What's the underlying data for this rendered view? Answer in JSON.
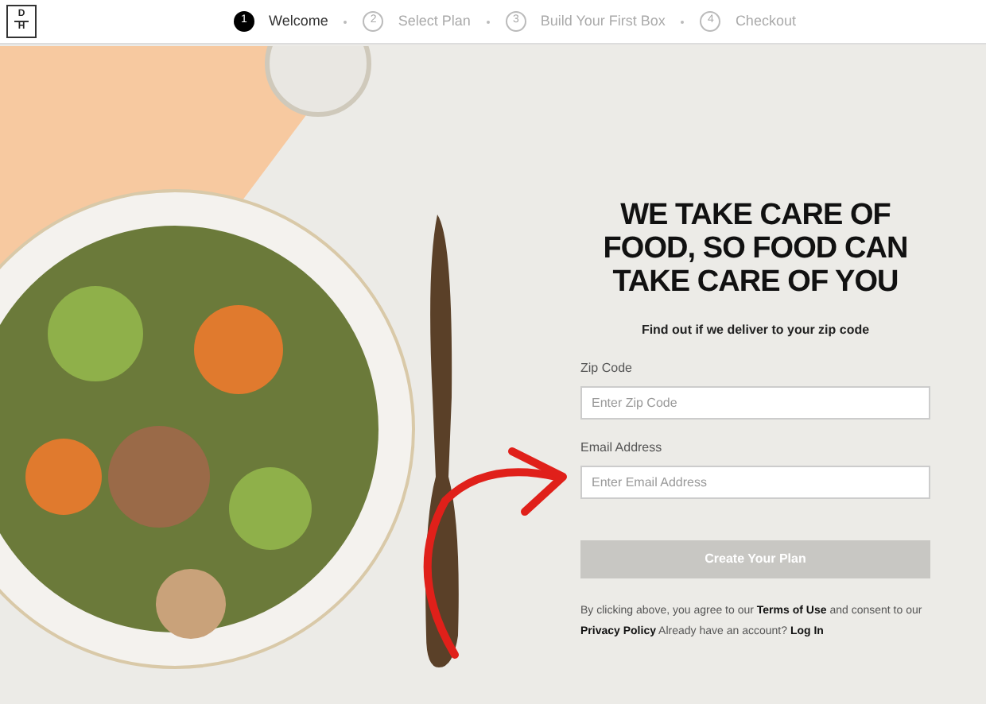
{
  "logo": {
    "top": "D",
    "bottom": "H"
  },
  "steps": [
    {
      "number": "1",
      "label": "Welcome",
      "selected": true
    },
    {
      "number": "2",
      "label": "Select Plan",
      "selected": false
    },
    {
      "number": "3",
      "label": "Build Your First Box",
      "selected": false
    },
    {
      "number": "4",
      "label": "Checkout",
      "selected": false
    }
  ],
  "heading": "WE TAKE CARE OF FOOD, SO FOOD CAN TAKE CARE OF YOU",
  "subheading": "Find out if we deliver to your zip code",
  "fields": [
    {
      "label": "Zip Code",
      "placeholder": "Enter Zip Code"
    },
    {
      "label": "Email Address",
      "placeholder": "Enter Email Address"
    }
  ],
  "submit": {
    "label": "Create Your Plan",
    "disabled": true
  },
  "legal": [
    {
      "kind": "text",
      "text": "By clicking above, you agree to our"
    },
    {
      "kind": "link",
      "text": "Terms of Use"
    },
    {
      "kind": "text",
      "text": "and consent to our"
    },
    {
      "kind": "link",
      "text": "Privacy Policy"
    },
    {
      "kind": "text",
      "text": "Already have an account?"
    },
    {
      "kind": "link",
      "text": "Log In"
    }
  ]
}
